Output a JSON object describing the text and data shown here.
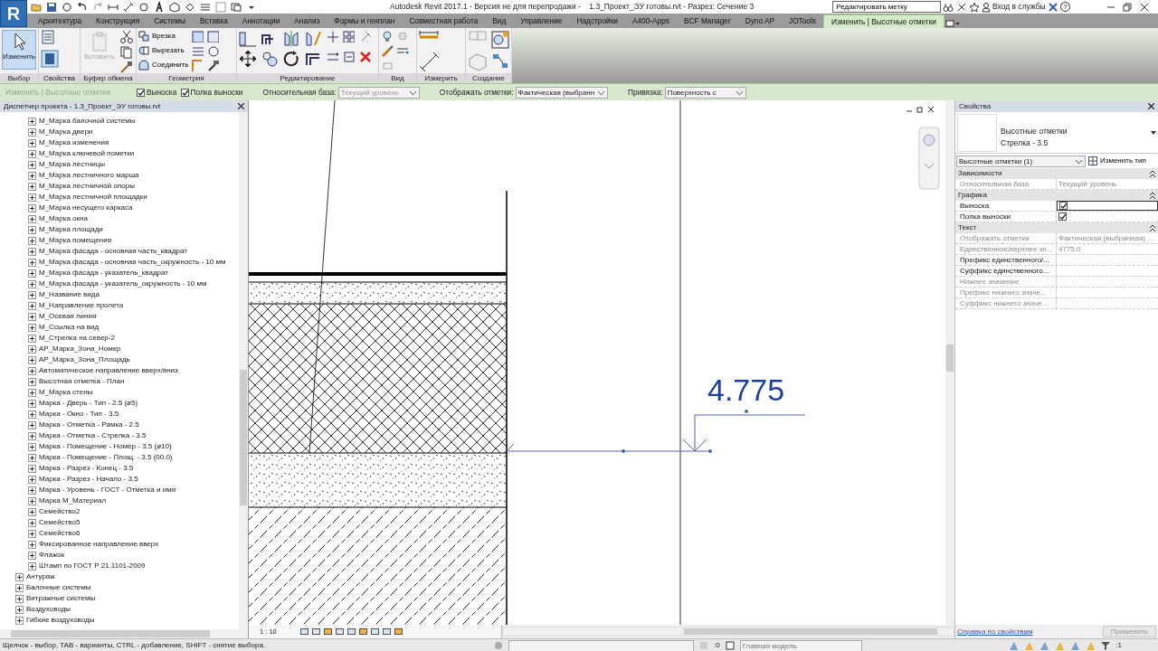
{
  "app_button": {
    "label": "R"
  },
  "title": "Autodesk Revit 2017.1 - Версия не для перепродажи -    1.3_Проект_ЭУ готовы.rvt - Разрез: Сечение 3",
  "search": {
    "value": "Редактировать метку"
  },
  "sign_in": "Вход в службы",
  "help": "?",
  "ribbon_tabs": [
    {
      "label": "Архитектура",
      "selected": false
    },
    {
      "label": "Конструкция",
      "selected": false
    },
    {
      "label": "Системы",
      "selected": false
    },
    {
      "label": "Вставка",
      "selected": false
    },
    {
      "label": "Аннотации",
      "selected": false
    },
    {
      "label": "Анализ",
      "selected": false
    },
    {
      "label": "Формы и генплан",
      "selected": false
    },
    {
      "label": "Совместная работа",
      "selected": false
    },
    {
      "label": "Вид",
      "selected": false
    },
    {
      "label": "Управление",
      "selected": false
    },
    {
      "label": "Надстройки",
      "selected": false
    },
    {
      "label": "A400-Apps",
      "selected": false
    },
    {
      "label": "BCF Manager",
      "selected": false
    },
    {
      "label": "Dyno AP",
      "selected": false
    },
    {
      "label": "JOTools",
      "selected": false
    },
    {
      "label": "Изменить | Высотные отметки",
      "selected": true
    }
  ],
  "ribbon_panels": [
    {
      "label": "Выбор",
      "tools": [
        {
          "label": "Изменить",
          "selected": true,
          "disabled": false
        }
      ]
    },
    {
      "label": "Свойства"
    },
    {
      "label": "Буфер обмена",
      "tools": [
        {
          "label": "Вставить",
          "disabled": true
        }
      ]
    },
    {
      "label": "Геометрия",
      "tools": [
        {
          "label": "Врезка",
          "disabled": false
        },
        {
          "label": "Вырезать",
          "disabled": false
        },
        {
          "label": "Соединить",
          "disabled": false
        }
      ]
    },
    {
      "label": "Редактирование"
    },
    {
      "label": "Вид"
    },
    {
      "label": "Измерить"
    },
    {
      "label": "Создание"
    }
  ],
  "options_bar": {
    "context": {
      "label": "Изменить | Высотные отметки",
      "disabled": true
    },
    "checkboxes": [
      {
        "label": "Выноска",
        "checked": true
      },
      {
        "label": "Полка выноски",
        "checked": true
      }
    ],
    "dropdowns": [
      {
        "label": "Относительная база:",
        "value": "Текущий уровень",
        "disabled": true
      },
      {
        "label": "Отображать отметки:",
        "value": "Фактическая (выбранн",
        "disabled": false
      },
      {
        "label": "Привязка:",
        "value": "Поверхность с",
        "disabled": false
      }
    ]
  },
  "project_browser": {
    "title": "Диспетчер проекта - 1.3_Проект_ЭУ готовы.rvt",
    "continued_items": [
      "М_Марка балочной системы",
      "М_Марка двери",
      "М_Марка изменения",
      "М_Марка ключевой пометки",
      "М_Марка лестницы",
      "М_Марка лестничного марша",
      "М_Марка лестничной опоры",
      "М_Марка лестничной площадки",
      "М_Марка несущего каркаса",
      "М_Марка окна",
      "М_Марка площади",
      "М_Марка помещения",
      "М_Марка фасада - основная часть_квадрат",
      "М_Марка фасада - основная часть_окружность - 10 мм",
      "М_Марка фасада - указатель_квадрат",
      "М_Марка фасада - указатель_окружность - 10 мм",
      "М_Название вида",
      "М_Направление пролета",
      "М_Осевая линия",
      "М_Ссылка на вид",
      "М_Стрелка на север-2",
      "АР_Марка_Зона_Номер",
      "АР_Марка_Зона_Площадь",
      "Автоматическое направление вверх/вниз",
      "Высотная отметка - План",
      "М_Марка стены",
      "Марка - Дверь - Тип - 2.5 (ø5)",
      "Марка - Окно - Тип - 3.5",
      "Марка - Отметка - Рамка - 2.5",
      "Марка - Отметка - Стрелка - 3.5",
      "Марка - Помещение - Номер - 3.5 (ø10)",
      "Марка - Помещение - Площ. - 3.5 (00.0)",
      "Марка - Разрез - Конец - 3.5",
      "Марка - Разрез - Начало - 3.5",
      "Марка - Уровень - ГОСТ - Отметка и имя",
      "Марка М_Материал",
      "Семейство2",
      "Семейство5",
      "Семейство6",
      "Фиксированное направление вверх",
      "Флажок",
      "Штамп по ГОСТ Р 21.1101-2009"
    ],
    "items": [
      "Антураж",
      "Балочные системы",
      "Витражные системы",
      "Воздуховоды",
      "Гибкие воздуховоды"
    ]
  },
  "view": {
    "spot_elevation": "4.775",
    "scale": "1 : 10"
  },
  "properties": {
    "title": "Свойства",
    "family": "Высотные отметки",
    "type": "Стрелка - 3.5",
    "selector": "Высотные отметки (1)",
    "edit_type": "Изменить тип",
    "groups": [
      {
        "label": "Зависимости",
        "rows": [
          {
            "name": "Относительная база",
            "kind": "text",
            "value": "Текущий уровень",
            "disabled": true,
            "selected": false
          }
        ]
      },
      {
        "label": "Графика",
        "rows": [
          {
            "name": "Выноска",
            "kind": "checkbox",
            "checked": true,
            "disabled": false,
            "selected": true
          },
          {
            "name": "Полка выноски",
            "kind": "checkbox",
            "checked": true,
            "disabled": false,
            "selected": false
          }
        ]
      },
      {
        "label": "Текст",
        "rows": [
          {
            "name": "Отображать отметки",
            "kind": "text",
            "value": "Фактическая (выбранная) ...",
            "disabled": true,
            "selected": false
          },
          {
            "name": "Единственное/верхнее зн...",
            "kind": "text",
            "value": "4775.0",
            "disabled": true,
            "selected": false
          },
          {
            "name": "Префикс единственного/...",
            "kind": "text",
            "disabled": false,
            "selected": false
          },
          {
            "name": "Суффикс единственного...",
            "kind": "text",
            "disabled": false,
            "selected": false
          },
          {
            "name": "Нижнее значение",
            "kind": "text",
            "disabled": true,
            "selected": false
          },
          {
            "name": "Префикс нижнего значе...",
            "kind": "text",
            "disabled": true,
            "selected": false
          },
          {
            "name": "Суффикс нижнего значе...",
            "kind": "text",
            "disabled": true,
            "selected": false
          }
        ]
      }
    ],
    "help_link": "Справка по свойствам",
    "apply": {
      "label": "Применить",
      "disabled": true
    }
  },
  "status_bar": {
    "hint": "Щелчок - выбор, TAB - варианты, CTRL - добавление, SHIFT - снятие выбора.",
    "worksets": ":0",
    "model": "Главная модель",
    "filter": ":1"
  }
}
